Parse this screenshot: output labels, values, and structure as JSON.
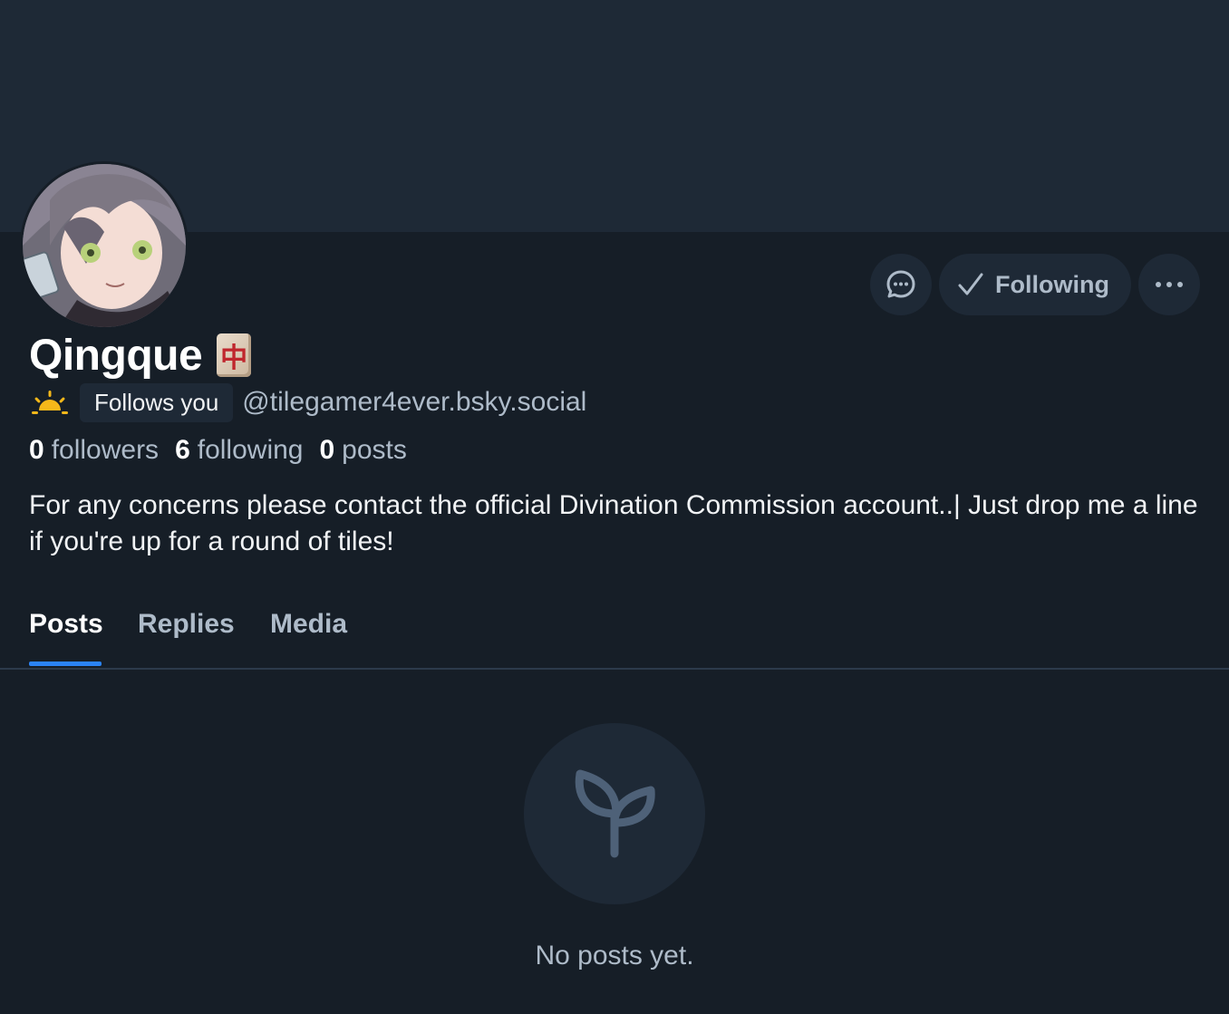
{
  "profile": {
    "display_name": "Qingque",
    "name_emoji": "中",
    "follows_you": "Follows you",
    "handle": "@tilegamer4ever.bsky.social",
    "bio": "For any concerns please contact the official Divination Commission account..| Just drop me a line if you're up for a round of tiles!"
  },
  "stats": {
    "followers_count": "0",
    "followers_label": "followers",
    "following_count": "6",
    "following_label": "following",
    "posts_count": "0",
    "posts_label": "posts"
  },
  "actions": {
    "message_icon": "chat-bubble-icon",
    "following_label": "Following",
    "more_icon": "ellipsis-icon"
  },
  "tabs": [
    {
      "label": "Posts",
      "active": true
    },
    {
      "label": "Replies",
      "active": false
    },
    {
      "label": "Media",
      "active": false
    }
  ],
  "empty_state": {
    "icon": "sprout-icon",
    "message": "No posts yet."
  },
  "colors": {
    "background": "#161e27",
    "banner": "#1e2936",
    "accent": "#2b84f6",
    "muted_text": "#aebbc9"
  }
}
